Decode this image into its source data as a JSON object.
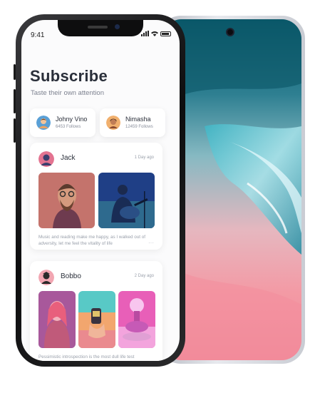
{
  "status_bar": {
    "time": "9:41"
  },
  "header": {
    "title": "Subscribe",
    "subtitle": "Taste their own attention"
  },
  "follow_cards": [
    {
      "name": "Johny Vino",
      "follows": "6453 Follows"
    },
    {
      "name": "Nimasha",
      "follows": "12459 Follows"
    }
  ],
  "posts": [
    {
      "author": "Jack",
      "time": "1 Day ago",
      "text": "Music and reading make me happy, as I walked out of adversity, let me feel the vitality of life",
      "more": "···"
    },
    {
      "author": "Bobbo",
      "time": "2 Day ago",
      "text": "Pessimistic introspection is the most dull life test"
    }
  ],
  "colors": {
    "accent_pink": "#f08a99",
    "title": "#2a2f3a",
    "muted": "#9aa0ab"
  }
}
